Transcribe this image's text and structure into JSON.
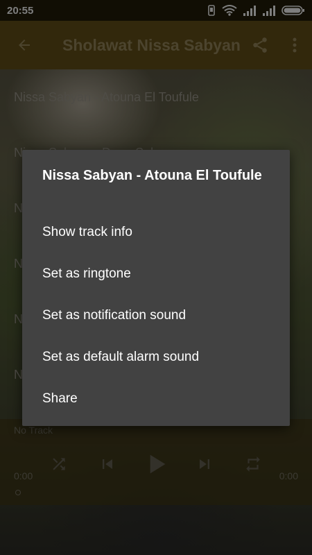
{
  "status_bar": {
    "time": "20:55",
    "icons": [
      "vibrate-icon",
      "wifi-icon",
      "signal-icon",
      "signal-icon",
      "battery-icon"
    ]
  },
  "app_bar": {
    "title": "Sholawat Nissa Sabyan",
    "back_icon": "arrow-back-icon",
    "share_icon": "share-icon",
    "menu_icon": "more-vert-icon"
  },
  "playlist": [
    "Nissa Sabyan - Atouna El Toufule",
    "Nissa Sabyan - Deen Salam",
    "N",
    "N",
    "N",
    "N"
  ],
  "player": {
    "now_playing": "No Track",
    "time_elapsed": "0:00",
    "time_total": "0:00",
    "icons": [
      "shuffle-icon",
      "skip-previous-icon",
      "play-icon",
      "skip-next-icon",
      "repeat-icon"
    ]
  },
  "dialog": {
    "title": "Nissa Sabyan - Atouna El Toufule",
    "options": [
      "Show track info",
      "Set as ringtone",
      "Set as notification sound",
      "Set as default alarm sound",
      "Share"
    ]
  },
  "colors": {
    "status_bar": "#1f1b08",
    "app_bar": "#5b4a16",
    "dialog_bg": "#424242",
    "dialog_text": "#ffffff"
  }
}
